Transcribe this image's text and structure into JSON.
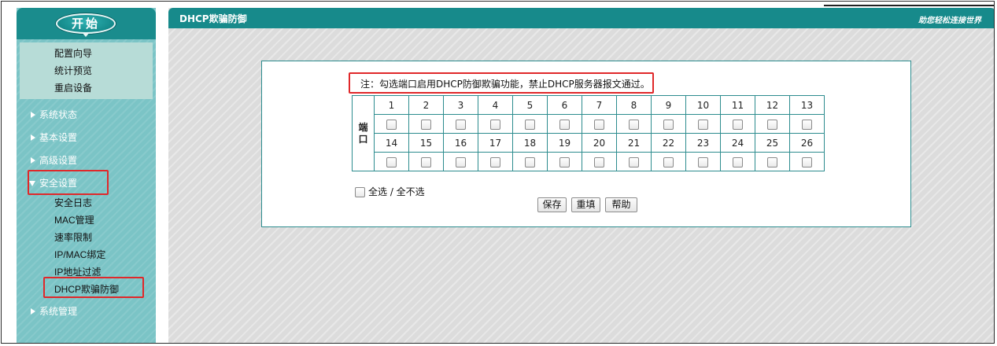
{
  "sidebar": {
    "start_label": "开始",
    "quick": [
      "配置向导",
      "统计预览",
      "重启设备"
    ],
    "nav": {
      "status": "系统状态",
      "basic": "基本设置",
      "advanced": "高级设置",
      "security": "安全设置",
      "system": "系统管理"
    },
    "security_sub": [
      "安全日志",
      "MAC管理",
      "速率限制",
      "IP/MAC绑定",
      "IP地址过滤",
      "DHCP欺骗防御"
    ]
  },
  "main": {
    "title": "DHCP欺骗防御",
    "slogan": "助您轻松连接世界",
    "note": "注：勾选端口启用DHCP防御欺骗功能，禁止DHCP服务器报文通过。",
    "port_label": "端口",
    "ports_row1": [
      "1",
      "2",
      "3",
      "4",
      "5",
      "6",
      "7",
      "8",
      "9",
      "10",
      "11",
      "12",
      "13"
    ],
    "ports_row2": [
      "14",
      "15",
      "16",
      "17",
      "18",
      "19",
      "20",
      "21",
      "22",
      "23",
      "24",
      "25",
      "26"
    ],
    "select_all": "全选 / 全不选",
    "buttons": {
      "save": "保存",
      "reset": "重填",
      "help": "帮助"
    }
  },
  "colors": {
    "teal": "#178a8b",
    "sidebar": "#7bc4c6",
    "highlight": "#e0282a"
  }
}
